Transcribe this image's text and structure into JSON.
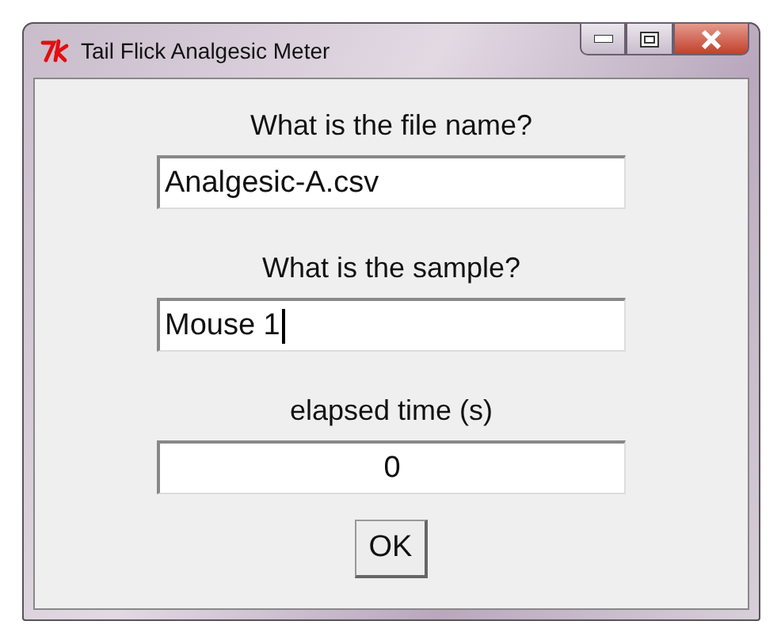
{
  "window": {
    "title": "Tail Flick Analgesic Meter"
  },
  "form": [
    {
      "kind": "label",
      "text": "What is the file name?"
    },
    {
      "kind": "entry",
      "value": "Analgesic-A.csv",
      "focused": false
    },
    {
      "kind": "label",
      "text": "What is the sample?"
    },
    {
      "kind": "entry",
      "value": "Mouse 1",
      "focused": true
    },
    {
      "kind": "label",
      "text": "elapsed time (s)"
    },
    {
      "kind": "readout",
      "value": "0"
    }
  ],
  "buttons": [
    "OK"
  ]
}
